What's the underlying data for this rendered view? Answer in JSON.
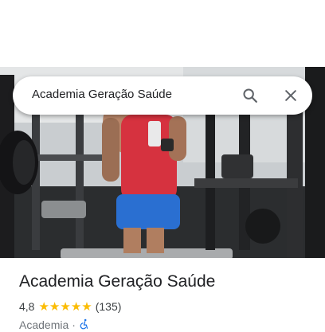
{
  "search": {
    "query": "Academia Geração Saúde"
  },
  "place": {
    "title": "Academia Geração Saúde",
    "rating": "4,8",
    "star_count": 5,
    "review_count": "(135)",
    "category": "Academia",
    "separator": "·",
    "access_icon": "accessibility-icon"
  },
  "colors": {
    "star": "#fbbc04",
    "accessibility": "#1a73e8",
    "shirt": "#d6323f",
    "shorts": "#2a6fd1"
  },
  "icons": {
    "search": "search-icon",
    "close": "close-icon"
  }
}
